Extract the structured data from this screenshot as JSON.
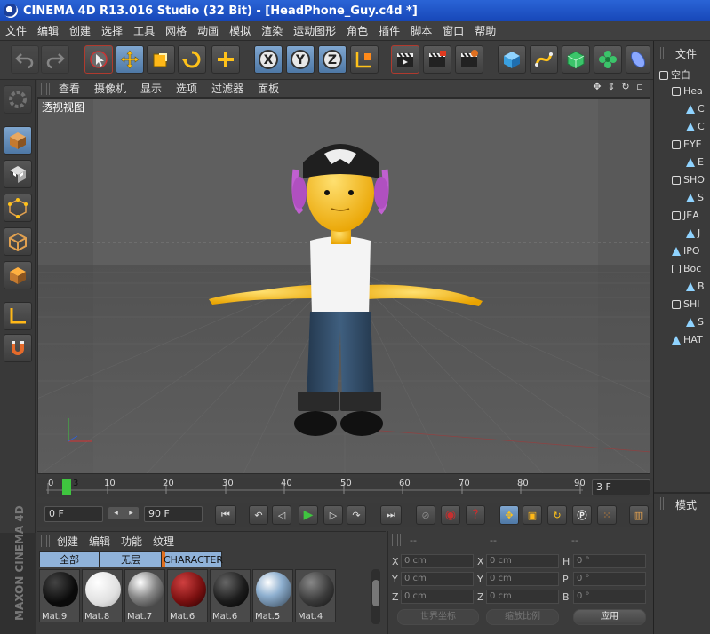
{
  "window": {
    "title": "CINEMA 4D R13.016 Studio (32 Bit) - [HeadPhone_Guy.c4d *]"
  },
  "menubar": [
    "文件",
    "编辑",
    "创建",
    "选择",
    "工具",
    "网格",
    "动画",
    "模拟",
    "渲染",
    "运动图形",
    "角色",
    "插件",
    "脚本",
    "窗口",
    "帮助"
  ],
  "viewport_menu": [
    "查看",
    "摄像机",
    "显示",
    "选项",
    "过滤器",
    "面板"
  ],
  "viewport_label": "透视视图",
  "timeline": {
    "ticks": [
      "0",
      "10",
      "20",
      "30",
      "40",
      "50",
      "60",
      "70",
      "80",
      "90"
    ],
    "current_marker": "3",
    "frame_display": "3 F"
  },
  "playbar": {
    "start_field": "0 F",
    "end_field": "90 F"
  },
  "materials": {
    "menu": [
      "创建",
      "编辑",
      "功能",
      "纹理"
    ],
    "tabs": [
      "全部",
      "无层",
      "CHARACTER"
    ],
    "items": [
      {
        "label": "Mat.9",
        "color": "#0a0a0a"
      },
      {
        "label": "Mat.8",
        "color": "#f2f2f2"
      },
      {
        "label": "Mat.7",
        "color": "#888888"
      },
      {
        "label": "Mat.6",
        "color": "#7a1010"
      },
      {
        "label": "Mat.6",
        "color": "#1c1c1c"
      },
      {
        "label": "Mat.5",
        "color": "#5a7fa0"
      },
      {
        "label": "Mat.4",
        "color": "#3a3a3a"
      }
    ]
  },
  "branding": "MAXON CINEMA 4D",
  "coordinates": {
    "headers": [
      "--",
      "--",
      "--"
    ],
    "rows": [
      {
        "a": "X",
        "a_val": "0 cm",
        "b": "X",
        "b_val": "0 cm",
        "c": "H",
        "c_val": "0 °"
      },
      {
        "a": "Y",
        "a_val": "0 cm",
        "b": "Y",
        "b_val": "0 cm",
        "c": "P",
        "c_val": "0 °"
      },
      {
        "a": "Z",
        "a_val": "0 cm",
        "b": "Z",
        "b_val": "0 cm",
        "c": "B",
        "c_val": "0 °"
      }
    ],
    "world_dropdown": "世界坐标",
    "scale_dropdown": "缩放比例",
    "apply_button": "应用"
  },
  "object_manager": {
    "tab": "文件",
    "items": [
      {
        "label": "空白",
        "indent": 0
      },
      {
        "label": "Hea",
        "indent": 1
      },
      {
        "label": "C",
        "indent": 2
      },
      {
        "label": "C",
        "indent": 2
      },
      {
        "label": "EYE",
        "indent": 1
      },
      {
        "label": "E",
        "indent": 2
      },
      {
        "label": "SHO",
        "indent": 1
      },
      {
        "label": "S",
        "indent": 2
      },
      {
        "label": "JEA",
        "indent": 1
      },
      {
        "label": "J",
        "indent": 2
      },
      {
        "label": "IPO",
        "indent": 1
      },
      {
        "label": "Boc",
        "indent": 1
      },
      {
        "label": "B",
        "indent": 2
      },
      {
        "label": "SHI",
        "indent": 1
      },
      {
        "label": "S",
        "indent": 2
      },
      {
        "label": "HAT",
        "indent": 1
      }
    ],
    "lower_tab": "模式"
  },
  "colors": {
    "accent": "#6f9cd0",
    "play_green": "#3fc53f",
    "record_red": "#c63030"
  }
}
